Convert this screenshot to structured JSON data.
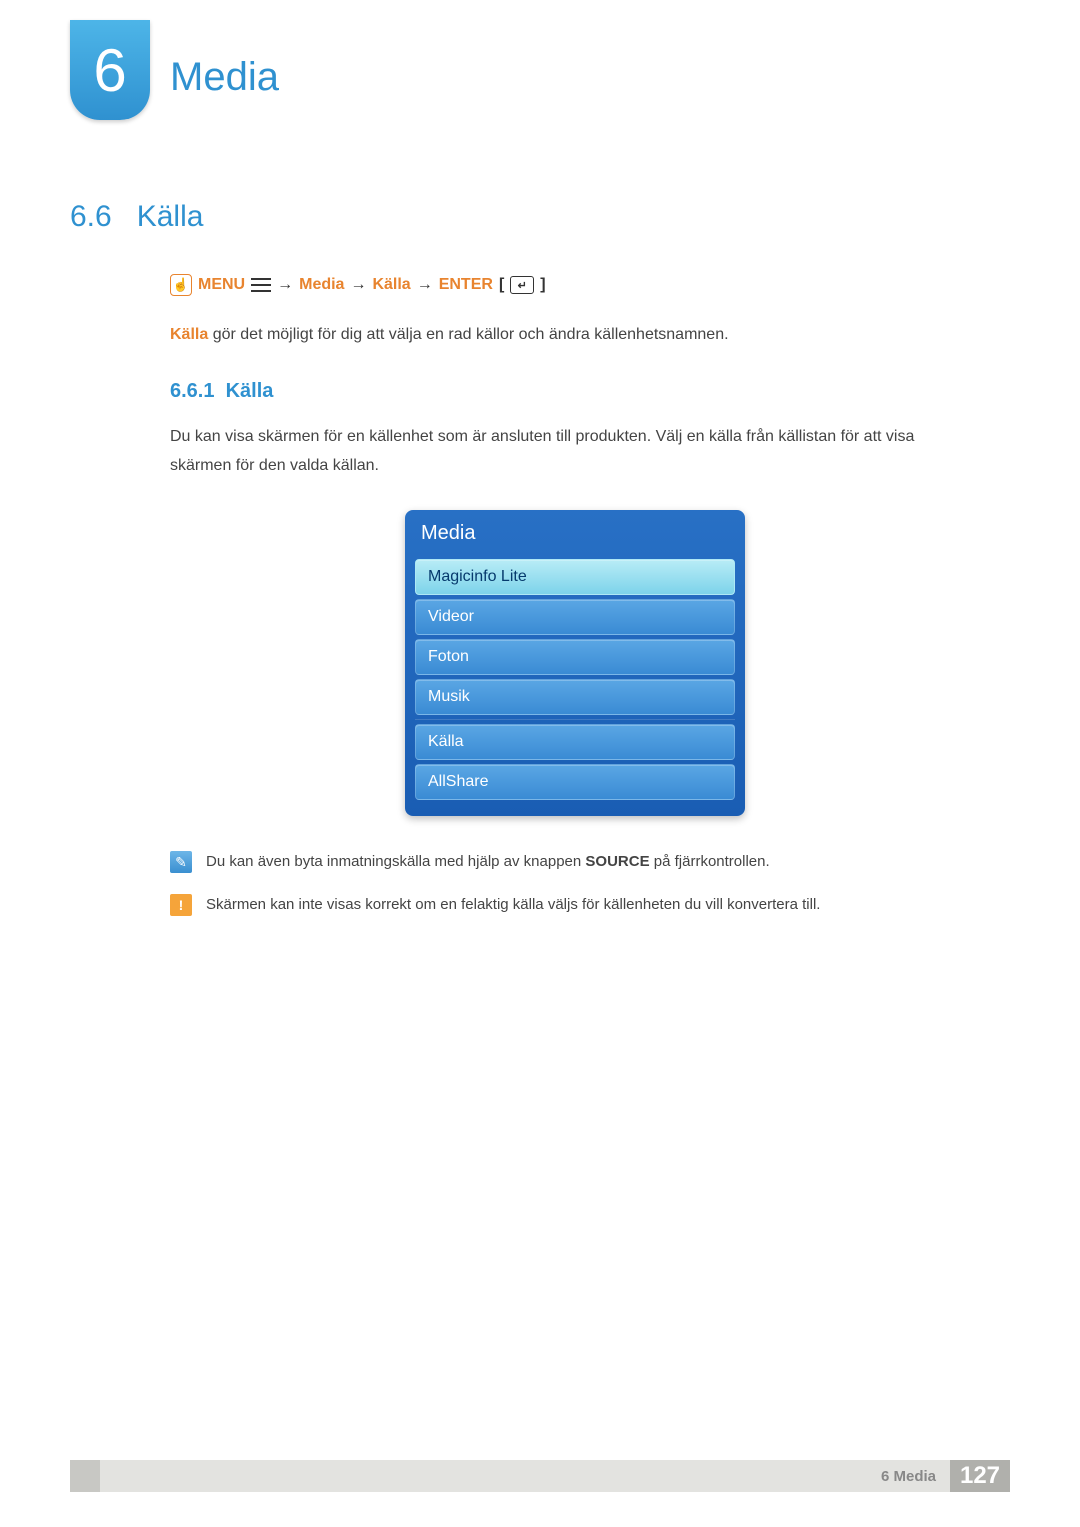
{
  "chapter": {
    "number": "6",
    "title": "Media"
  },
  "section": {
    "number": "6.6",
    "title": "Källa"
  },
  "navpath": {
    "menu_label": "MENU",
    "step1": "Media",
    "step2": "Källa",
    "enter_label": "ENTER",
    "arrow": "→"
  },
  "intro": {
    "bold": "Källa",
    "rest": " gör det möjligt för dig att välja en rad källor och ändra källenhetsnamnen."
  },
  "subsection": {
    "number": "6.6.1",
    "title": "Källa",
    "text": "Du kan visa skärmen för en källenhet som är ansluten till produkten. Välj en källa från källistan för att visa skärmen för den valda källan."
  },
  "menu": {
    "title": "Media",
    "items": [
      {
        "label": "Magicinfo Lite",
        "highlighted": true
      },
      {
        "label": "Videor",
        "highlighted": false
      },
      {
        "label": "Foton",
        "highlighted": false
      },
      {
        "label": "Musik",
        "highlighted": false
      },
      {
        "label": "Källa",
        "highlighted": false
      },
      {
        "label": "AllShare",
        "highlighted": false
      }
    ]
  },
  "notes": {
    "tip_pre": "Du kan även byta inmatningskälla med hjälp av knappen ",
    "tip_bold": "SOURCE",
    "tip_post": " på fjärrkontrollen.",
    "warn": "Skärmen kan inte visas korrekt om en felaktig källa väljs för källenheten du vill konvertera till."
  },
  "footer": {
    "label": "6 Media",
    "page": "127"
  }
}
